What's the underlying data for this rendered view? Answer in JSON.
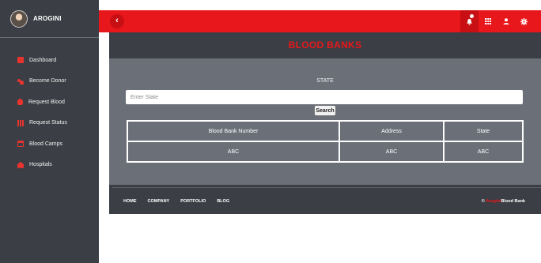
{
  "sidebar": {
    "brand_name": "AROGINI",
    "items": [
      {
        "label": "Dashboard",
        "icon": "dashboard-icon"
      },
      {
        "label": "Become Donor",
        "icon": "donor-icon"
      },
      {
        "label": "Request Blood",
        "icon": "blood-drop-icon"
      },
      {
        "label": "Request Status",
        "icon": "status-icon"
      },
      {
        "label": "Blood Camps",
        "icon": "calendar-icon"
      },
      {
        "label": "Hospitals",
        "icon": "hospital-icon"
      }
    ]
  },
  "topbar": {
    "back_symbol": "‹",
    "icons": [
      "notification-bell-icon",
      "grid-icon",
      "user-icon",
      "settings-gear-icon"
    ]
  },
  "main": {
    "title": "BLOOD BANKS",
    "state_label": "STATE",
    "state_placeholder": "Enter State",
    "search_label": "Search",
    "table": {
      "headers": [
        "Blood Bank Number",
        "Address",
        "State"
      ],
      "rows": [
        [
          "ABC",
          "ABC",
          "ABC"
        ]
      ]
    }
  },
  "footer": {
    "links": [
      "HOME",
      "COMPANY",
      "PORTFOLIO",
      "BLOG"
    ],
    "copyright_prefix": "©",
    "copyright_highlight": "Arogini",
    "copyright_suffix": "Blood Bank"
  },
  "colors": {
    "accent_red": "#e8171b",
    "sidebar_bg": "#3b3e44",
    "card_bg": "#6a6f78"
  }
}
